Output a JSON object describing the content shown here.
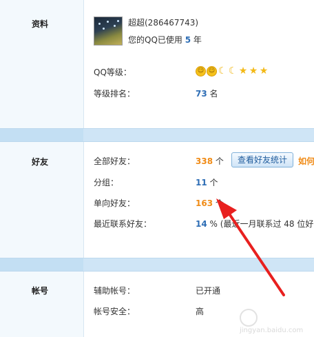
{
  "profile": {
    "section": "资料",
    "name": "超超(286467743)",
    "usage_prefix": "您的QQ已使用",
    "usage_years": "5",
    "usage_suffix": "年",
    "level_label": "QQ等级：",
    "level_icons": [
      "sun-icon",
      "sun-icon",
      "moon-icon",
      "moon-icon",
      "star-icon",
      "star-icon",
      "star-icon"
    ],
    "rank_label": "等级排名：",
    "rank_value": "73",
    "rank_unit": "名"
  },
  "friends": {
    "section": "好友",
    "all_label": "全部好友：",
    "all_value": "338",
    "all_unit": "个",
    "stats_button": "查看好友统计",
    "more_link": "如何",
    "group_label": "分组：",
    "group_value": "11",
    "group_unit": "个",
    "oneway_label": "单向好友：",
    "oneway_value": "163",
    "oneway_unit": "个",
    "recent_label": "最近联系好友：",
    "recent_value": "14",
    "recent_unit": "%",
    "recent_text": "(最近一月联系过 48 位好"
  },
  "account": {
    "section": "帐号",
    "aux_label": "辅助帐号：",
    "aux_value": "已开通",
    "security_label": "帐号安全：",
    "security_value": "高"
  },
  "watermark": "jingyan.baidu.com",
  "colors": {
    "accent_blue": "#2d6db5",
    "accent_orange": "#f08b16",
    "arrow_red": "#e8201f"
  }
}
